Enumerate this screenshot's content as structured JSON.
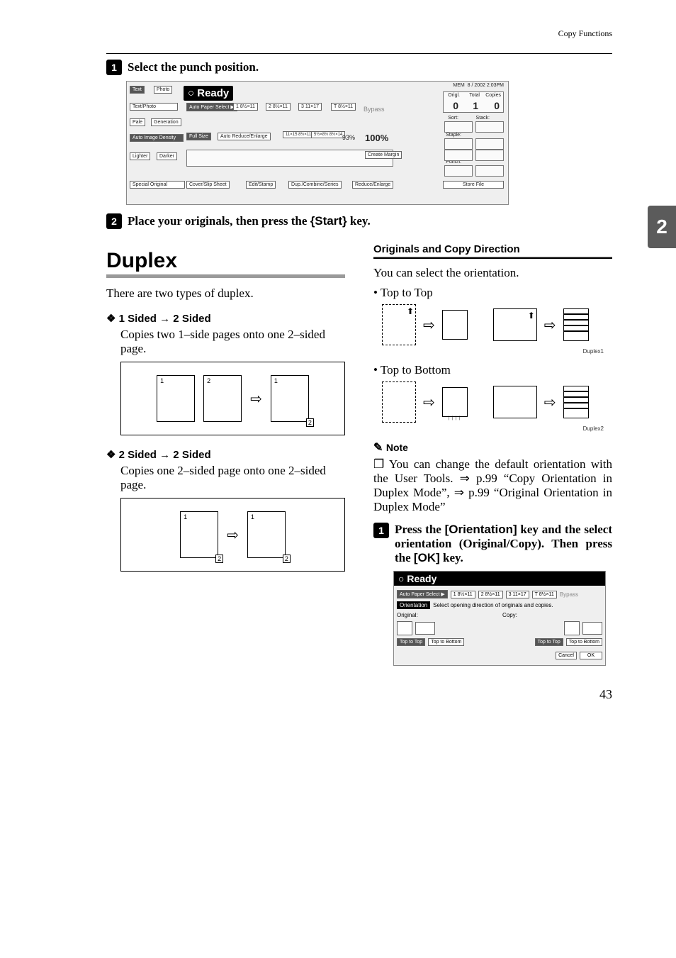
{
  "header": {
    "section": "Copy Functions"
  },
  "sidebar": {
    "chapter": "2"
  },
  "steps": {
    "s1": "Select the punch position.",
    "s2_pre": "Place your originals, then press the ",
    "s2_key": "{Start}",
    "s2_post": " key."
  },
  "lcd_large": {
    "ready": "Ready",
    "left_tabs": [
      "Text",
      "Photo",
      "Text/Photo",
      "Pale",
      "Generation",
      "Auto Image Density",
      "Lighter",
      "Darker",
      "Special Original"
    ],
    "auto_paper": "Auto Paper Select ▶",
    "trays": [
      "1 8½×11",
      "2 8½×11",
      "3 11×17",
      "T 8½×11",
      "Bypass"
    ],
    "mid_buttons": [
      "Full Size",
      "Auto Reduce/Enlarge"
    ],
    "ratio_presets": [
      "11×15 8½×11",
      "5½×8½ 8½×14"
    ],
    "ratio_value": "93%",
    "magnification": "100%",
    "create_margin": "Create Margin",
    "bottom_row": [
      "Cover/Slip Sheet",
      "Edit/Stamp",
      "Dup./Combine/Series",
      "Reduce/Enlarge"
    ],
    "top_right": {
      "origl": "Origl.",
      "total": "Total",
      "copies": "Copies",
      "origl_v": "0",
      "total_v": "1",
      "copies_v": "0",
      "time": "8 / 2002  2:03PM",
      "mem": "MEM"
    },
    "right_labels": [
      "Sort:",
      "Stack:",
      "Staple:",
      "Punch:"
    ],
    "store_file": "Store File"
  },
  "duplex": {
    "title": "Duplex",
    "intro": "There are two types of duplex.",
    "mode1_title": "1 Sided → 2 Sided",
    "mode1_desc": "Copies two 1–side pages onto one 2–sided page.",
    "mode2_title": "2 Sided → 2 Sided",
    "mode2_desc": "Copies one 2–sided page onto one 2–sided page."
  },
  "direction": {
    "title": "Originals and Copy Direction",
    "intro": "You can select the orientation.",
    "opt1": "Top to Top",
    "cap1": "Duplex1",
    "opt2": "Top to Bottom",
    "cap2": "Duplex2"
  },
  "note": {
    "head": "Note",
    "body": "You can change the default orientation with the User Tools. ⇒ p.99 “Copy Orientation in Duplex Mode”, ⇒ p.99 “Original Orientation in Duplex Mode”"
  },
  "step_orientation": {
    "pre": "Press the ",
    "k1": "[Orientation]",
    "mid": " key and the select orientation (Original/Copy). Then press the ",
    "k2": "[OK]",
    "post": " key."
  },
  "lcd_small": {
    "ready": "Ready",
    "auto_paper": "Auto Paper Select ▶",
    "trays": [
      "1 8½×11",
      "2 8½×11",
      "3 11×17",
      "T 8½×11",
      "Bypass"
    ],
    "orientation_label": "Orientation",
    "orientation_hint": "Select opening direction of originals and copies.",
    "original_label": "Original:",
    "copy_label": "Copy:",
    "options": [
      "Top to Top",
      "Top to Bottom",
      "Top to Top",
      "Top to Bottom"
    ],
    "cancel": "Cancel",
    "ok": "OK"
  },
  "page_number": "43"
}
